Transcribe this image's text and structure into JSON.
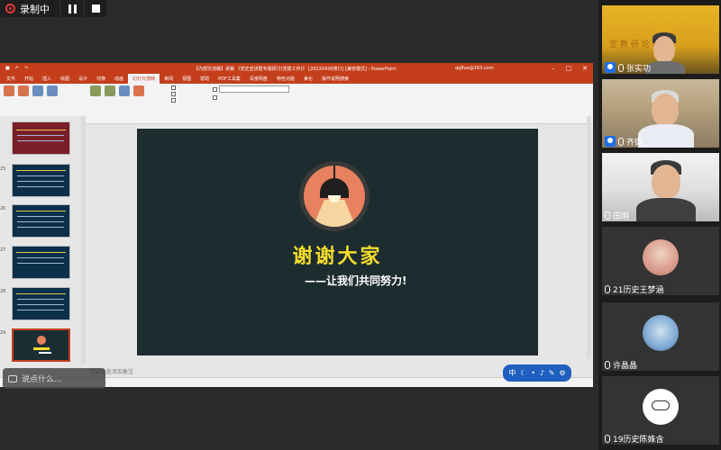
{
  "recording": {
    "label": "录制中"
  },
  "ppt": {
    "title_doc": "【内部交流稿】讲稿 《党史宣讲暨专题研讨(党建工作)》 [20220426修订] [兼容模式] - PowerPoint",
    "user": "qq8ue@163.com",
    "tabs": [
      "文件",
      "开始",
      "插入",
      "绘图",
      "设计",
      "切换",
      "动画",
      "幻灯片放映",
      "审阅",
      "视图",
      "帮助",
      "PDF工具集",
      "百度网盘",
      "特色功能",
      "美化",
      "操作说明搜索"
    ],
    "notes_placeholder": "单击此处添加备注"
  },
  "slide": {
    "title": "谢谢大家",
    "subtitle": "——让我们共同努力!"
  },
  "thumbnails": {
    "numbers": [
      "25",
      "26",
      "27",
      "28",
      "29"
    ]
  },
  "speak": {
    "label": "说点什么..."
  },
  "participants": [
    {
      "name": "张实功"
    },
    {
      "name": "齐健"
    },
    {
      "name": "田明"
    },
    {
      "name": "21历史王梦涵"
    },
    {
      "name": "许晶晶"
    },
    {
      "name": "19历史陈姝含"
    }
  ]
}
